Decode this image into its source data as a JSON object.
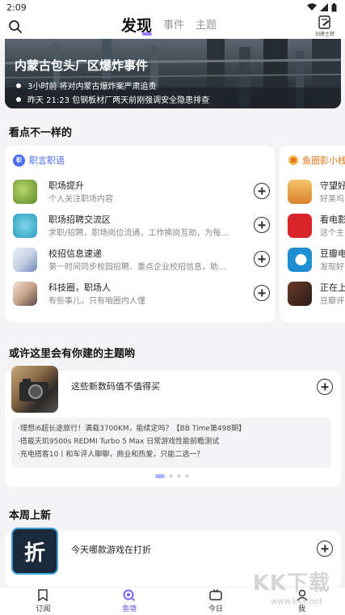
{
  "status": {
    "time": "2:09"
  },
  "nav": {
    "tabs": [
      {
        "label": "发现",
        "active": true
      },
      {
        "label": "事件",
        "active": false
      },
      {
        "label": "主题",
        "active": false
      }
    ],
    "create_label": "创建主题"
  },
  "hero": {
    "title": "内蒙古包头厂区爆炸事件",
    "lines": [
      "3小时前 将对内蒙古爆炸案严肃追责",
      "昨天 21:23 包钢板材厂两天前刚强调安全隐患排查"
    ]
  },
  "sections": {
    "different": "看点不一样的",
    "build_topic": "或许这里会有你建的主题哟",
    "new_week": "本周上新"
  },
  "card_career": {
    "header": "职言职语",
    "badge": "职",
    "items": [
      {
        "title": "职场提升",
        "sub": "个人关注职场内容"
      },
      {
        "title": "职场招聘交流区",
        "sub": "求职/招聘，职场岗位流通，工作换岗互助，为每…"
      },
      {
        "title": "校招信息速递",
        "sub": "第一时间同步校园招聘、重点企业校招信息，助…"
      },
      {
        "title": "科技圈，职场人",
        "sub": "有些事儿，只有咱圈内人懂"
      }
    ]
  },
  "card_fish": {
    "header": "鱼圈影小栈",
    "items": [
      {
        "title": "守望好",
        "sub": "好莱坞"
      },
      {
        "title": "看电影",
        "sub": "这个主"
      },
      {
        "title": "豆瓣电",
        "sub": "发现好"
      },
      {
        "title": "正在上",
        "sub": "豆瓣评"
      }
    ]
  },
  "topic": {
    "title": "这些新数码值不值得买",
    "lines": [
      "·理想i6超长途旅行！满载3700KM，能续定吗？【BB Time第498期】",
      "·搭载天玑9500s REDMI Turbo 5 Max 日常游戏性能前瞻测试",
      "·充电搭客10丨和车评人聊聊，商业和热爱，只能二选一？"
    ]
  },
  "new_item": {
    "title": "今天哪款游戏在打折",
    "icon_text": "折"
  },
  "bottom_nav": [
    {
      "label": "订阅",
      "active": false
    },
    {
      "label": "鱼塘",
      "active": true
    },
    {
      "label": "今日",
      "active": false
    },
    {
      "label": "我",
      "active": false
    }
  ],
  "watermark": {
    "main": "KK下载",
    "sub": "www.kkx.net"
  },
  "colors": {
    "accent": "#6a5cff",
    "link": "#4a6cf7",
    "fish_header": "#e07b1a"
  }
}
